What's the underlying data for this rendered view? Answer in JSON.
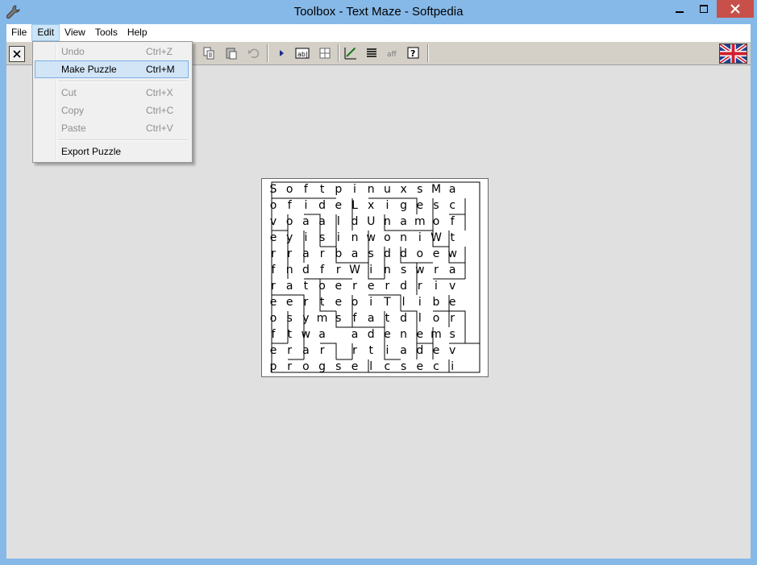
{
  "window": {
    "title": "Toolbox - Text Maze - Softpedia",
    "minimize_label": "–",
    "maximize_label": "▢",
    "close_label": "✕"
  },
  "menubar": {
    "items": [
      "File",
      "Edit",
      "View",
      "Tools",
      "Help"
    ],
    "active": "Edit"
  },
  "edit_menu": {
    "items": [
      {
        "label": "Undo",
        "shortcut": "Ctrl+Z",
        "disabled": true
      },
      {
        "label": "Make Puzzle",
        "shortcut": "Ctrl+M",
        "highlighted": true
      },
      {
        "label": "Cut",
        "shortcut": "Ctrl+X",
        "disabled": true
      },
      {
        "label": "Copy",
        "shortcut": "Ctrl+C",
        "disabled": true
      },
      {
        "label": "Paste",
        "shortcut": "Ctrl+V",
        "disabled": true
      },
      {
        "label": "Export Puzzle",
        "shortcut": ""
      }
    ]
  },
  "toolbar": {
    "close_doc": "✕",
    "abl": "ab|",
    "help": "?"
  },
  "maze": {
    "rows": [
      [
        "S",
        "o",
        "f",
        "t",
        "p",
        "i",
        "n",
        "u",
        "x",
        "s",
        "M",
        "a"
      ],
      [
        "o",
        "f",
        "i",
        "d",
        "e",
        "L",
        "x",
        "i",
        "g",
        "e",
        "s",
        "c"
      ],
      [
        "v",
        "o",
        "a",
        "a",
        "l",
        "d",
        "U",
        "n",
        "a",
        "m",
        "o",
        "f"
      ],
      [
        "e",
        "y",
        "i",
        "s",
        "i",
        "n",
        "w",
        "o",
        "n",
        "i",
        "W",
        "t"
      ],
      [
        "r",
        "r",
        "a",
        "r",
        "b",
        "a",
        "s",
        "d",
        "d",
        "o",
        "e",
        "w"
      ],
      [
        "f",
        "n",
        "d",
        "f",
        "r",
        "W",
        "i",
        "n",
        "s",
        "w",
        "r",
        "a"
      ],
      [
        "r",
        "a",
        "t",
        "o",
        "e",
        "r",
        "e",
        "r",
        "d",
        "r",
        "i",
        "v"
      ],
      [
        "e",
        "e",
        "r",
        "t",
        "e",
        "o",
        "i",
        "T",
        "l",
        "i",
        "b",
        "e"
      ],
      [
        "o",
        "s",
        "y",
        "m",
        "s",
        "f",
        "a",
        "t",
        "d",
        "l",
        "o",
        "r"
      ],
      [
        "f",
        "t",
        "w",
        "a",
        "",
        "a",
        "d",
        "e",
        "n",
        "e",
        "m",
        "s"
      ],
      [
        "e",
        "r",
        "a",
        "r",
        "",
        "r",
        "t",
        "i",
        "a",
        "d",
        "e",
        "v"
      ],
      [
        "p",
        "r",
        "o",
        "g",
        "s",
        "e",
        "l",
        "c",
        "s",
        "e",
        "c",
        "i"
      ]
    ]
  },
  "colors": {
    "frame": "#86b9e8",
    "close_button": "#c7504b",
    "client_bg": "#e0e0e0",
    "highlight": "#d1e5f7"
  }
}
